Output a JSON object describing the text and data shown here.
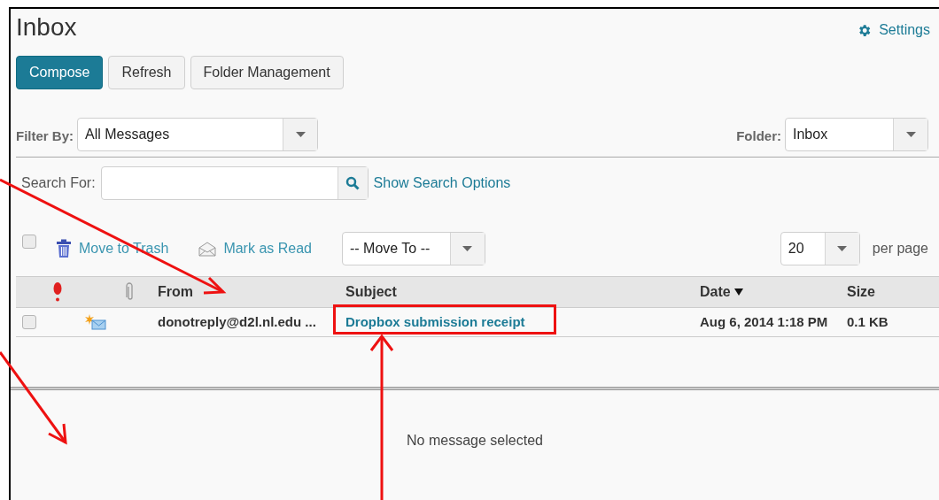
{
  "title": "Inbox",
  "settings": {
    "label": "Settings"
  },
  "buttons": [
    {
      "label": "Compose",
      "kind": "primary"
    },
    {
      "label": "Refresh",
      "kind": "default"
    },
    {
      "label": "Folder Management",
      "kind": "default"
    }
  ],
  "filter": {
    "label": "Filter By:",
    "value": "All Messages"
  },
  "folder": {
    "label": "Folder:",
    "value": "Inbox"
  },
  "search": {
    "label": "Search For:",
    "options_link": "Show Search Options"
  },
  "toolbar": {
    "select_all_checked": false,
    "actions": [
      {
        "label": "Move to Trash",
        "kind": "trash"
      },
      {
        "label": "Mark as Read",
        "kind": "read"
      }
    ],
    "move_to": "-- Move To --",
    "per_page": "20",
    "per_page_label": "per page"
  },
  "columns": [
    {
      "label": "From",
      "sorted": false
    },
    {
      "label": "Subject",
      "sorted": false
    },
    {
      "label": "Date",
      "sorted": true
    },
    {
      "label": "Size",
      "sorted": false
    }
  ],
  "rows": [
    {
      "checked": false,
      "unread": true,
      "from": "donotreply@d2l.nl.edu ...",
      "subject": "Dropbox submission receipt",
      "date": "Aug 6, 2014 1:18 PM",
      "size": "0.1 KB"
    }
  ],
  "preview": {
    "message": "No message selected"
  }
}
